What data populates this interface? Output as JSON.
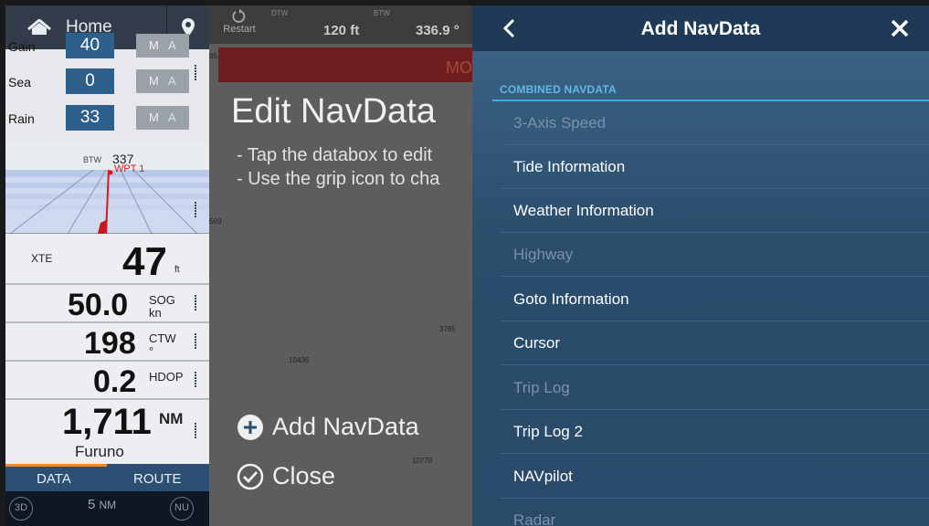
{
  "left_panel": {
    "home_label": "Home",
    "controls": [
      {
        "label": "Gain",
        "value": "40",
        "mode": "M",
        "auto": "A"
      },
      {
        "label": "Sea",
        "value": "0",
        "mode": "M",
        "auto": "A"
      },
      {
        "label": "Rain",
        "value": "33",
        "mode": "M",
        "auto": "A"
      }
    ],
    "highway": {
      "btw_label": "BTW",
      "btw_value": "337",
      "waypoint": "WPT 1"
    },
    "xte": {
      "label": "XTE",
      "value": "47",
      "unit": "ft"
    },
    "sog": {
      "value": "50.0",
      "label": "SOG",
      "unit": "kn"
    },
    "ctw": {
      "value": "198",
      "label": "CTW",
      "unit": "°"
    },
    "hdop": {
      "value": "0.2",
      "label": "HDOP"
    },
    "distance": {
      "value": "1,711",
      "unit": "NM",
      "name": "Furuno"
    },
    "tabs": {
      "data": "DATA",
      "route": "ROUTE"
    },
    "bottom": {
      "view": "3D",
      "scale_value": "5",
      "scale_unit": "NM",
      "orientation": "NU"
    }
  },
  "middle_panel": {
    "restart": "Restart",
    "dtw_label": "DTW",
    "dtw_value": "120 ft",
    "btw_label": "BTW",
    "btw_value": "336.9 °",
    "banner_text": "MO",
    "title": "Edit NavData",
    "tips": [
      "- Tap the databox to edit",
      "- Use the grip icon to cha"
    ],
    "map_numbers": [
      "85",
      "569",
      "3765",
      "10436",
      "10778"
    ],
    "add_label": "Add NavData",
    "close_label": "Close"
  },
  "right_panel": {
    "title": "Add NavData",
    "section_label": "COMBINED NAVDATA",
    "items": [
      {
        "label": "3-Axis Speed",
        "enabled": false
      },
      {
        "label": "Tide Information",
        "enabled": true
      },
      {
        "label": "Weather Information",
        "enabled": true
      },
      {
        "label": "Highway",
        "enabled": false
      },
      {
        "label": "Goto Information",
        "enabled": true
      },
      {
        "label": "Cursor",
        "enabled": true
      },
      {
        "label": "Trip Log",
        "enabled": false
      },
      {
        "label": "Trip Log 2",
        "enabled": true
      },
      {
        "label": "NAVpilot",
        "enabled": true
      },
      {
        "label": "Radar",
        "enabled": false
      }
    ]
  },
  "colors": {
    "accent": "#5fb9e8",
    "header_bg": "#1f3a56",
    "panel_bg": "#2b4d6c",
    "value_box": "#2e5f8a",
    "tab_indicator": "#f08a24",
    "overlay_bg": "#5d5d5d"
  }
}
